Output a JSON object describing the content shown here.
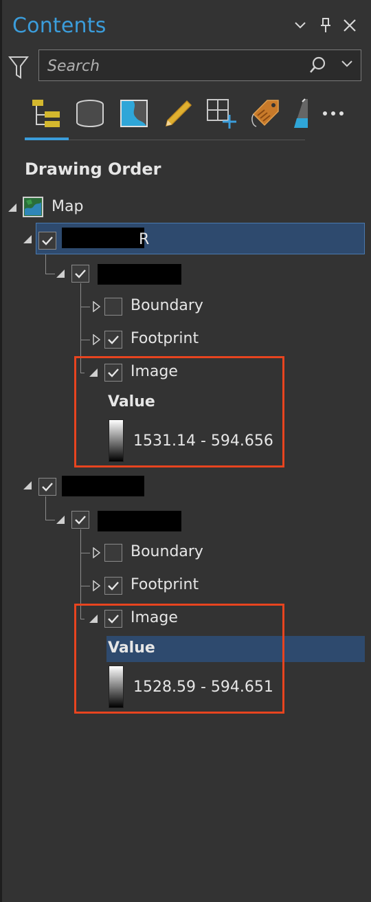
{
  "panel": {
    "title": "Contents",
    "search_placeholder": "Search",
    "section_title": "Drawing Order",
    "toolbar_icons": [
      "list-by-drawing-order-icon",
      "list-by-data-source-icon",
      "list-by-selection-icon",
      "list-by-editing-icon",
      "list-by-snapping-icon",
      "list-by-labeling-icon",
      "list-by-perspective-imagery-icon",
      "more-icon"
    ],
    "accent_color": "#3b9ddb",
    "callout_color": "#e8441f"
  },
  "tree": {
    "map_label": "Map",
    "layers": [
      {
        "name_visible_suffix": "R",
        "selected": true,
        "children": [
          {
            "label": "Boundary",
            "checked": false
          },
          {
            "label": "Footprint",
            "checked": true
          },
          {
            "label": "Image",
            "checked": true,
            "legend_header": "Value",
            "range": "1531.14 - 594.656"
          }
        ]
      },
      {
        "name_visible_suffix": "",
        "selected": false,
        "children": [
          {
            "label": "Boundary",
            "checked": false
          },
          {
            "label": "Footprint",
            "checked": true
          },
          {
            "label": "Image",
            "checked": true,
            "legend_header": "Value",
            "range": "1528.59 - 594.651",
            "legend_header_highlighted": true
          }
        ]
      }
    ]
  }
}
